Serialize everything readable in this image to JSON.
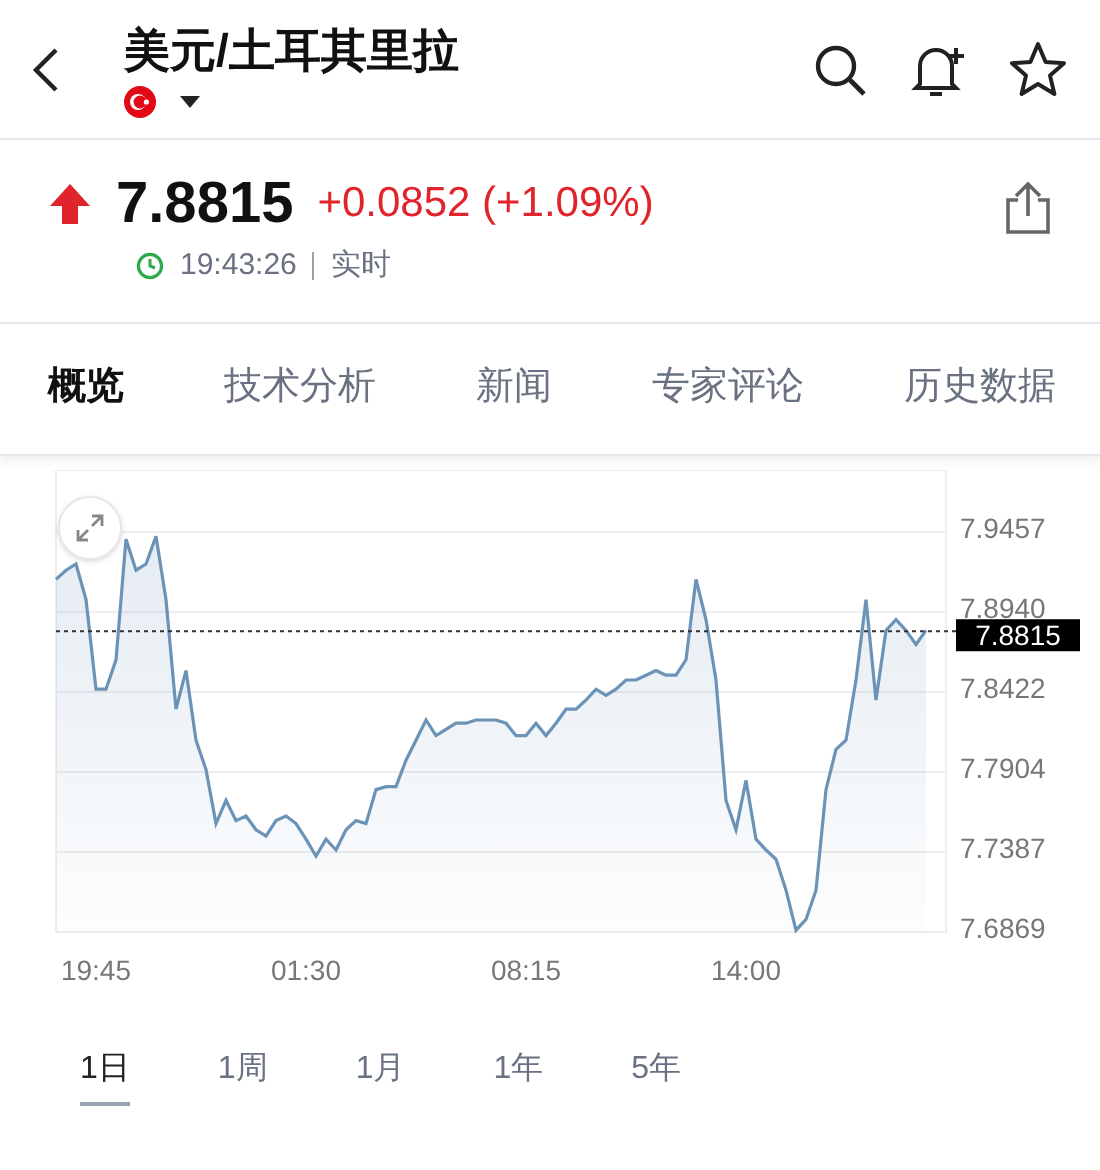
{
  "header": {
    "title": "美元/土耳其里拉"
  },
  "quote": {
    "price": "7.8815",
    "change": "+0.0852 (+1.09%)",
    "time": "19:43:26",
    "status": "实时"
  },
  "tabs": [
    {
      "label": "概览",
      "selected": true
    },
    {
      "label": "技术分析",
      "selected": false
    },
    {
      "label": "新闻",
      "selected": false
    },
    {
      "label": "专家评论",
      "selected": false
    },
    {
      "label": "历史数据",
      "selected": false
    }
  ],
  "chart": {
    "time_labels": [
      "19:45",
      "01:30",
      "08:15",
      "14:00"
    ],
    "chart_data": {
      "type": "area",
      "grid": true,
      "series": [
        {
          "color": "#6b93b8",
          "values": [
            7.915,
            7.921,
            7.925,
            7.902,
            7.844,
            7.844,
            7.863,
            7.941,
            7.921,
            7.925,
            7.943,
            7.902,
            7.831,
            7.856,
            7.811,
            7.792,
            7.757,
            7.772,
            7.759,
            7.762,
            7.753,
            7.749,
            7.759,
            7.762,
            7.757,
            7.747,
            7.736,
            7.747,
            7.74,
            7.753,
            7.759,
            7.757,
            7.779,
            7.781,
            7.781,
            7.798,
            7.811,
            7.824,
            7.814,
            7.818,
            7.822,
            7.822,
            7.824,
            7.824,
            7.824,
            7.822,
            7.814,
            7.814,
            7.822,
            7.814,
            7.822,
            7.831,
            7.831,
            7.837,
            7.844,
            7.84,
            7.844,
            7.85,
            7.85,
            7.853,
            7.856,
            7.853,
            7.853,
            7.863,
            7.915,
            7.889,
            7.85,
            7.772,
            7.753,
            7.785,
            7.747,
            7.74,
            7.734,
            7.714,
            7.688,
            7.695,
            7.714,
            7.779,
            7.805,
            7.811,
            7.85,
            7.902,
            7.837,
            7.882,
            7.889,
            7.882,
            7.873,
            7.882
          ]
        }
      ],
      "ylim": [
        7.6869,
        7.9457
      ],
      "yticks": [
        7.9457,
        {
          "value": 7.894,
          "label": "7.8940"
        },
        7.8422,
        7.7904,
        7.7387,
        7.6869
      ],
      "ref_lines": [
        {
          "axis": "y",
          "value": 7.8815,
          "label": "7.8815"
        }
      ]
    }
  },
  "ranges": [
    {
      "label": "1日",
      "selected": true
    },
    {
      "label": "1周",
      "selected": false
    },
    {
      "label": "1月",
      "selected": false
    },
    {
      "label": "1年",
      "selected": false
    },
    {
      "label": "5年",
      "selected": false
    }
  ]
}
